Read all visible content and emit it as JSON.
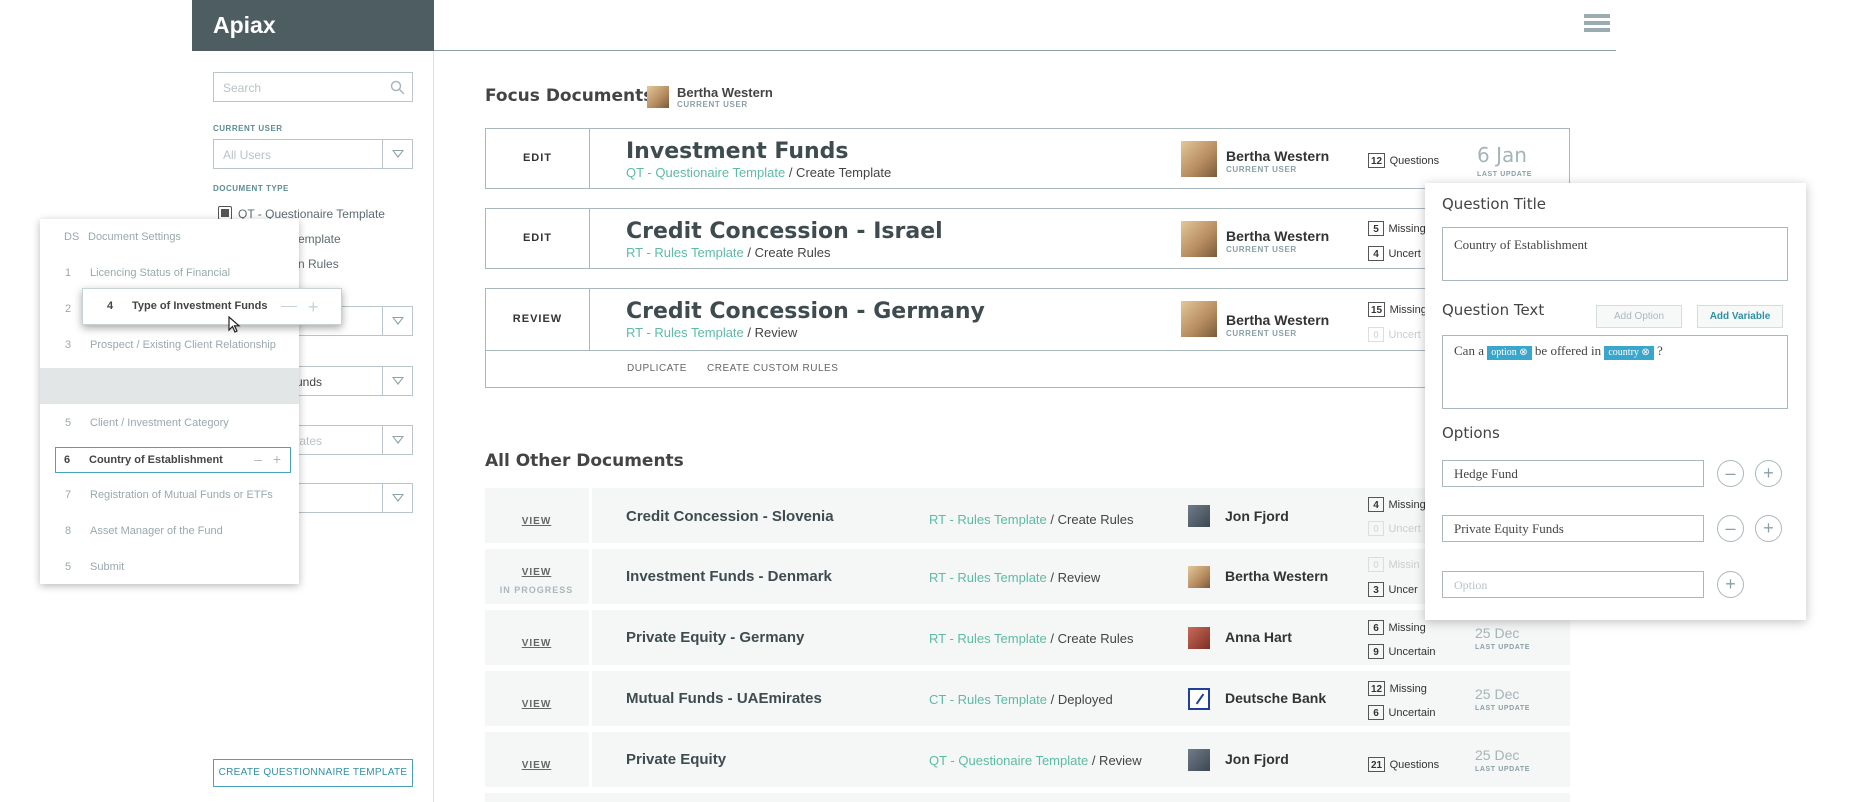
{
  "brand": "Apiax",
  "sidebar": {
    "search_placeholder": "Search",
    "current_user_label": "CURRENT USER",
    "current_user_value": "All Users",
    "document_type_label": "DOCUMENT TYPE",
    "doc_types": [
      "QT - Questionaire Template",
      "emplate",
      "n Rules"
    ],
    "filter_values": [
      "",
      "unds",
      "tates",
      ""
    ],
    "create_button": "CREATE QUESTIONNAIRE TEMPLATE"
  },
  "focus": {
    "title": "Focus Documents",
    "user_name": "Bertha Western",
    "user_sub": "CURRENT USER",
    "cards": [
      {
        "action": "EDIT",
        "title": "Investment Funds",
        "type": "QT - Questionaire Template",
        "step": " / Create Template",
        "user": "Bertha Western",
        "user_sub": "CURRENT USER",
        "badge1": "12",
        "badge1_label": "Questions",
        "date": "6 Jan",
        "date_sub": "LAST UPDATE"
      },
      {
        "action": "EDIT",
        "title": "Credit Concession - Israel",
        "type": "RT - Rules Template",
        "step": " / Create Rules",
        "user": "Bertha Western",
        "user_sub": "CURRENT USER",
        "badge1": "5",
        "badge1_label": "Missing",
        "badge2": "4",
        "badge2_label": "Uncert"
      },
      {
        "action": "REVIEW",
        "title": "Credit Concession - Germany",
        "type": "RT - Rules Template",
        "step": " / Review",
        "user": "Bertha Western",
        "user_sub": "CURRENT USER",
        "badge1": "15",
        "badge1_label": "Missing",
        "badge2": "0",
        "badge2_label": "Uncert"
      }
    ],
    "sub_actions": [
      "DUPLICATE",
      "CREATE CUSTOM RULES"
    ]
  },
  "others": {
    "title": "All Other Documents",
    "rows": [
      {
        "action": "VIEW",
        "action2": "",
        "title": "Credit Concession - Slovenia",
        "type": "RT - Rules Template",
        "step": " / Create Rules",
        "user": "Jon Fjord",
        "b1": "4",
        "b1l": "Missing",
        "b2": "0",
        "b2l": "Uncert"
      },
      {
        "action": "VIEW",
        "action2": "IN PROGRESS",
        "title": "Investment Funds - Denmark",
        "type": "RT - Rules Template",
        "step": " / Review",
        "user": "Bertha Western",
        "b1": "0",
        "b1l": "Missin",
        "b2": "3",
        "b2l": "Uncer"
      },
      {
        "action": "VIEW",
        "action2": "",
        "title": "Private Equity - Germany",
        "type": "RT - Rules Template",
        "step": " / Create Rules",
        "user": "Anna Hart",
        "b1": "6",
        "b1l": "Missing",
        "b2": "9",
        "b2l": "Uncertain",
        "date": "25 Dec",
        "date_sub": "LAST UPDATE"
      },
      {
        "action": "VIEW",
        "action2": "",
        "title": "Mutual Funds - UAEmirates",
        "type": "CT - Rules Template",
        "step": " / Deployed",
        "user": "Deutsche Bank",
        "b1": "12",
        "b1l": "Missing",
        "b2": "6",
        "b2l": "Uncertain",
        "date": "25 Dec",
        "date_sub": "LAST UPDATE"
      },
      {
        "action": "VIEW",
        "action2": "",
        "title": "Private Equity",
        "type": "QT - Questionaire Template",
        "step": " / Review",
        "user": "Jon Fjord",
        "b1": "21",
        "b1l": "Questions",
        "date": "25 Dec",
        "date_sub": "LAST UPDATE"
      }
    ]
  },
  "list_panel": {
    "items": [
      {
        "n": "DS",
        "t": "Document Settings"
      },
      {
        "n": "1",
        "t": "Licencing Status of Financial"
      },
      {
        "n": "2",
        "t": ""
      },
      {
        "n": "3",
        "t": "Prospect / Existing Client Relationship"
      },
      {
        "n": "",
        "t": ""
      },
      {
        "n": "5",
        "t": "Client / Investment Category"
      },
      {
        "n": "6",
        "t": "Country of Establishment"
      },
      {
        "n": "7",
        "t": "Registration of Mutual Funds or ETFs"
      },
      {
        "n": "8",
        "t": "Asset Manager of the Fund"
      },
      {
        "n": "5",
        "t": "Submit"
      }
    ],
    "drag_n": "4",
    "drag_t": "Type of Investment Funds"
  },
  "question": {
    "title_label": "Question Title",
    "title_value": "Country of Establishment",
    "text_label": "Question Text",
    "add_option": "Add Option",
    "add_variable": "Add Variable",
    "text_pre": "Can a",
    "var1": "option",
    "text_mid": "be offered in",
    "var2": "country",
    "text_post": "?",
    "options_label": "Options",
    "options": [
      "Hedge Fund",
      "Private Equity Funds"
    ],
    "option_placeholder": "Option"
  }
}
